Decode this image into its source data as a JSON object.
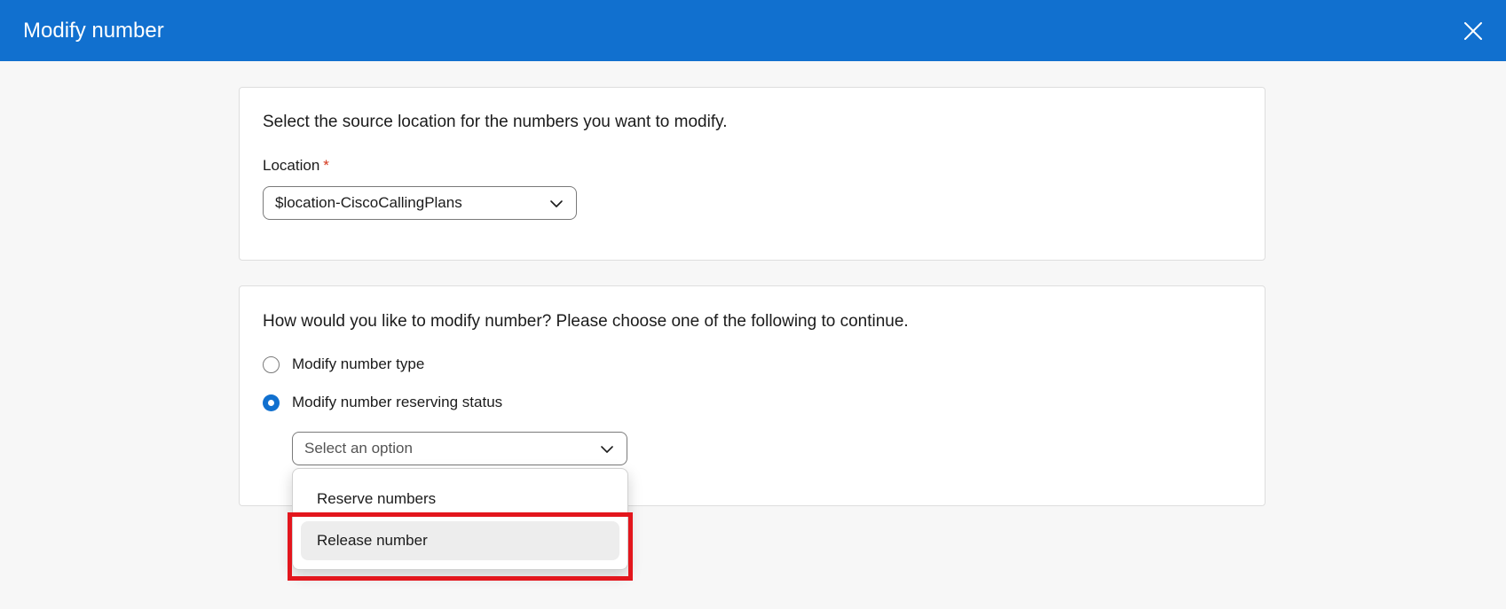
{
  "header": {
    "title": "Modify number",
    "close_icon": "close-icon"
  },
  "location_card": {
    "instruction": "Select the source location for the numbers you want to modify.",
    "location_label": "Location",
    "required_mark": "*",
    "location_value": "$location-CiscoCallingPlans"
  },
  "modify_card": {
    "question": "How would you like to modify number? Please choose one of the following to continue.",
    "options": [
      {
        "label": "Modify number type",
        "selected": false
      },
      {
        "label": "Modify number reserving status",
        "selected": true
      }
    ],
    "select_placeholder": "Select an option",
    "dropdown_items": [
      {
        "label": "Reserve numbers"
      },
      {
        "label": "Release number",
        "hovered": true
      }
    ]
  },
  "colors": {
    "header_bg": "#1170cf",
    "accent": "#1170cf",
    "highlight": "#e3161d",
    "required": "#d4371c"
  }
}
